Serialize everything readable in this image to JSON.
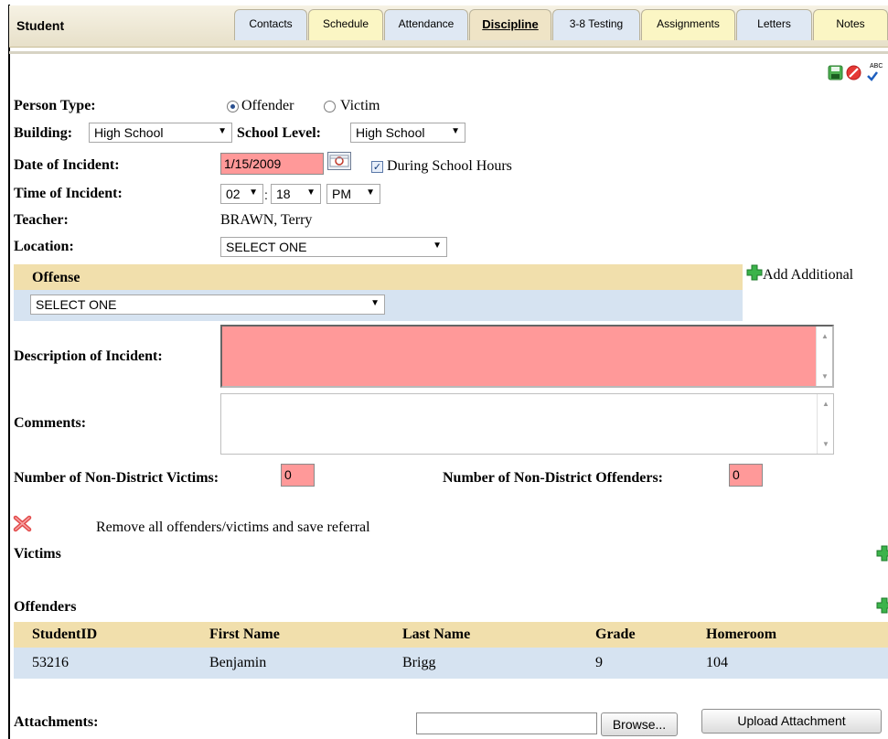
{
  "header": {
    "title": "Student",
    "tabs": [
      {
        "label": "Contacts",
        "style": "blue"
      },
      {
        "label": "Schedule",
        "style": "yellow"
      },
      {
        "label": "Attendance",
        "style": "blue"
      },
      {
        "label": "Discipline",
        "style": "active"
      },
      {
        "label": "3-8 Testing",
        "style": "blue"
      },
      {
        "label": "Assignments",
        "style": "yellow"
      },
      {
        "label": "Letters",
        "style": "blue"
      },
      {
        "label": "Notes",
        "style": "yellow"
      }
    ]
  },
  "toolbar": {
    "icons": [
      "save-icon",
      "cancel-icon",
      "spellcheck-icon"
    ],
    "spellcheck_label": "ABC"
  },
  "form": {
    "person_type_label": "Person Type:",
    "person_type_options": [
      "Offender",
      "Victim"
    ],
    "person_type_selected": "Offender",
    "building_label": "Building:",
    "building_value": "High School",
    "school_level_label": "School Level:",
    "school_level_value": "High School",
    "date_label": "Date of Incident:",
    "date_value": "1/15/2009",
    "during_hours_label": "During School Hours",
    "during_hours_checked": true,
    "time_label": "Time of Incident:",
    "time_hour": "02",
    "time_minute": "18",
    "time_separator": ":",
    "time_ampm": "PM",
    "teacher_label": "Teacher:",
    "teacher_value": "BRAWN, Terry",
    "location_label": "Location:",
    "location_value": "SELECT ONE"
  },
  "offense": {
    "header": "Offense",
    "add_label": "Add Additional",
    "value": "SELECT ONE"
  },
  "description_label": "Description of Incident:",
  "comments_label": "Comments:",
  "counts": {
    "victims_label": "Number of Non-District Victims:",
    "victims_value": "0",
    "offenders_label": "Number of Non-District Offenders:",
    "offenders_value": "0"
  },
  "remove_label": "Remove all offenders/victims and save referral",
  "victims_header": "Victims",
  "offenders": {
    "header": "Offenders",
    "columns": [
      "StudentID",
      "First Name",
      "Last Name",
      "Grade",
      "Homeroom"
    ],
    "rows": [
      [
        "53216",
        "Benjamin",
        "Brigg",
        "9",
        "104"
      ]
    ]
  },
  "attachments": {
    "label": "Attachments:",
    "browse_label": "Browse...",
    "upload_label": "Upload Attachment"
  },
  "colors": {
    "required_field": "#ff9999",
    "section_header": "#f1dfac",
    "row_highlight": "#d6e3f1"
  }
}
